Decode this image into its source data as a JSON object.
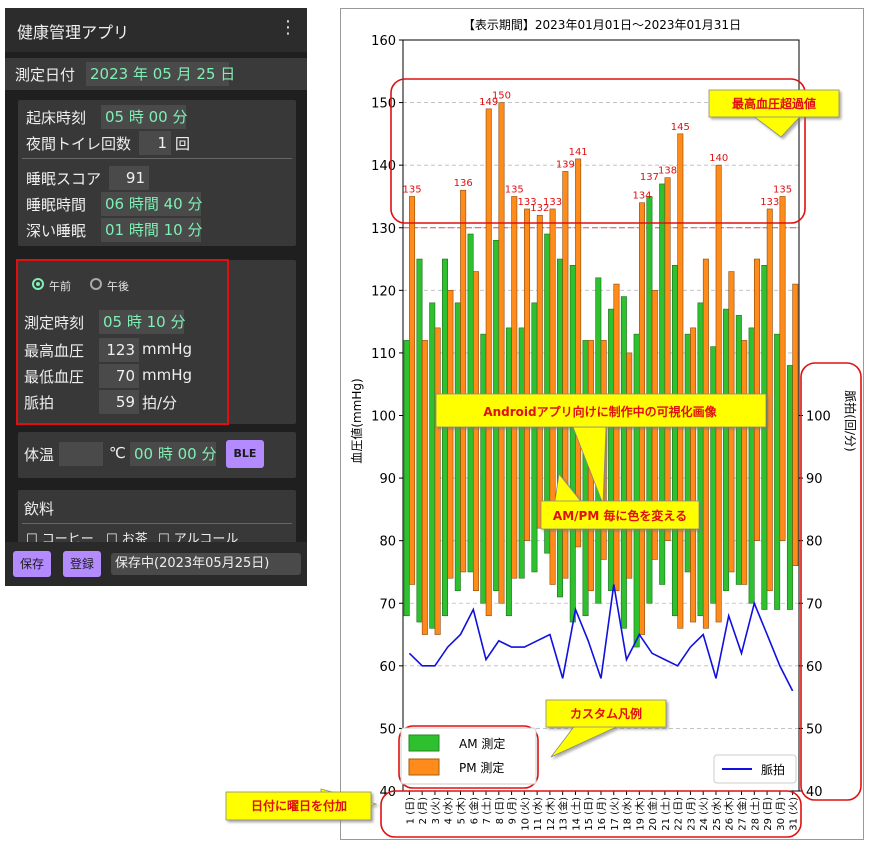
{
  "app": {
    "title": "健康管理アプリ",
    "menu_icon": "⋮",
    "date_label": "測定日付",
    "date_value": "2023 年 05 月 25 日",
    "sleep": {
      "wake_label": "起床時刻",
      "wake_value": "05 時 00 分",
      "toilet_label": "夜間トイレ回数",
      "toilet_value": "1",
      "toilet_unit": "回",
      "score_label": "睡眠スコア",
      "score_value": "91",
      "duration_label": "睡眠時間",
      "duration_value": "06 時間 40 分",
      "deep_label": "深い睡眠",
      "deep_value": "01 時間 10 分"
    },
    "bp": {
      "am_label": "午前",
      "pm_label": "午後",
      "selected": "am",
      "time_label": "測定時刻",
      "time_value": "05 時 10 分",
      "sys_label": "最高血圧",
      "sys_value": "123",
      "sys_unit": "mmHg",
      "dia_label": "最低血圧",
      "dia_value": "70",
      "dia_unit": "mmHg",
      "pulse_label": "脈拍",
      "pulse_value": "59",
      "pulse_unit": "拍/分"
    },
    "temp": {
      "label": "体温",
      "value": "",
      "unit": "℃",
      "time_value": "00 時 00 分",
      "ble_label": "BLE"
    },
    "drink": {
      "label": "飲料",
      "opt1": "コーヒー",
      "opt2": "お茶",
      "opt3": "アルコール"
    },
    "footer": {
      "save_label": "保存",
      "register_label": "登録",
      "status": "保存中(2023年05月25日)"
    }
  },
  "colors": {
    "am": "#2ec02e",
    "pm": "#ff8c1a",
    "pulse": "#1010e0",
    "annotation_red": "#e01010",
    "callout_fill": "#ffff00",
    "value_green": "#7ff0b5",
    "button_purple": "#b38bff"
  },
  "chart_data": {
    "type": "bar",
    "title": "【表示期間】2023年01月01日～2023年01月31日",
    "ylabel": "血圧値(mmHg)",
    "y2label": "脈拍(回/分)",
    "ylim": [
      40,
      160
    ],
    "y2lim": [
      40,
      110
    ],
    "yticks": [
      40,
      50,
      60,
      70,
      80,
      90,
      100,
      110,
      120,
      130,
      140,
      150,
      160
    ],
    "y2ticks": [
      40,
      50,
      60,
      70,
      80,
      90,
      100
    ],
    "threshold": 130,
    "grid": true,
    "categories": [
      "1 (日)",
      "2 (月)",
      "3 (火)",
      "4 (水)",
      "5 (木)",
      "6 (金)",
      "7 (土)",
      "8 (日)",
      "9 (月)",
      "10 (火)",
      "11 (水)",
      "12 (木)",
      "13 (金)",
      "14 (土)",
      "15 (日)",
      "16 (月)",
      "17 (火)",
      "18 (水)",
      "19 (木)",
      "20 (金)",
      "21 (土)",
      "22 (日)",
      "23 (月)",
      "24 (火)",
      "25 (水)",
      "26 (木)",
      "27 (金)",
      "28 (土)",
      "29 (日)",
      "30 (月)",
      "31 (火)"
    ],
    "series": [
      {
        "name": "AM 測定",
        "high": [
          112,
          125,
          118,
          125,
          118,
          129,
          113,
          128,
          114,
          114,
          118,
          129,
          125,
          124,
          112,
          122,
          117,
          119,
          113,
          135,
          137,
          124,
          113,
          118,
          111,
          117,
          116,
          114,
          124,
          113,
          108
        ],
        "low": [
          68,
          67,
          66,
          68,
          72,
          75,
          70,
          72,
          68,
          74,
          75,
          78,
          71,
          67,
          68,
          70,
          72,
          66,
          63,
          70,
          73,
          68,
          75,
          68,
          70,
          72,
          73,
          70,
          69,
          69,
          69
        ]
      },
      {
        "name": "PM 測定",
        "high": [
          135,
          112,
          114,
          120,
          136,
          123,
          149,
          150,
          135,
          133,
          132,
          133,
          139,
          141,
          112,
          112,
          121,
          110,
          134,
          120,
          138,
          145,
          114,
          125,
          140,
          123,
          112,
          125,
          133,
          135,
          121
        ],
        "low": [
          73,
          65,
          65,
          74,
          75,
          72,
          68,
          70,
          74,
          80,
          82,
          73,
          74,
          79,
          72,
          77,
          72,
          74,
          65,
          77,
          80,
          66,
          67,
          66,
          67,
          75,
          73,
          80,
          72,
          80,
          76
        ]
      },
      {
        "name": "脈拍",
        "values": [
          62,
          60,
          60,
          63,
          65,
          69,
          61,
          64,
          63,
          63,
          64,
          65,
          58,
          69,
          64,
          58,
          73,
          61,
          65,
          62,
          61,
          60,
          63,
          65,
          58,
          68,
          62,
          70,
          65,
          60,
          56
        ]
      }
    ],
    "value_labels": {
      "pm": [
        135,
        null,
        null,
        null,
        136,
        null,
        149,
        150,
        135,
        133,
        132,
        133,
        139,
        141,
        null,
        null,
        null,
        null,
        134,
        null,
        138,
        145,
        null,
        null,
        140,
        null,
        null,
        null,
        133,
        135,
        null
      ],
      "am": [
        null,
        null,
        null,
        null,
        null,
        null,
        null,
        null,
        null,
        null,
        null,
        null,
        null,
        null,
        null,
        null,
        null,
        null,
        null,
        137,
        null,
        null,
        null,
        null,
        null,
        null,
        null,
        null,
        null,
        null,
        null
      ]
    },
    "legend_left": [
      "AM 測定",
      "PM 測定"
    ],
    "legend_right": [
      "脈拍"
    ],
    "annotations": {
      "over": "最高血圧超過値",
      "android": "Androidアプリ向けに制作中の可視化画像",
      "ampm": "AM/PM 毎に色を変える",
      "legend": "カスタム凡例",
      "weekday": "日付に曜日を付加"
    }
  }
}
